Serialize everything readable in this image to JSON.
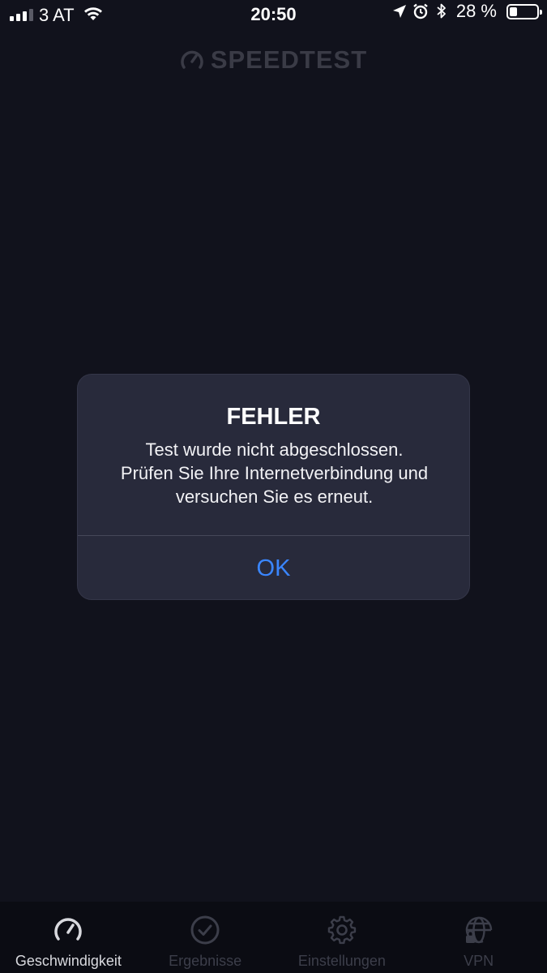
{
  "status_bar": {
    "carrier": "3 AT",
    "time": "20:50",
    "battery_percent": "28 %",
    "battery_level": 0.28,
    "icons": [
      "signal-icon",
      "wifi-icon",
      "location-arrow-icon",
      "alarm-icon",
      "bluetooth-icon",
      "battery-icon"
    ]
  },
  "header": {
    "logo_text": "SPEEDTEST"
  },
  "dialog": {
    "title": "FEHLER",
    "message_line1": "Test wurde nicht abgeschlossen.",
    "message_line2": "Prüfen Sie Ihre Internetverbindung und",
    "message_line3": "versuchen Sie es erneut.",
    "ok_label": "OK",
    "ok_color": "#3a86ff"
  },
  "tab_bar": {
    "tabs": [
      {
        "label": "Geschwindigkeit",
        "icon": "speedometer-icon",
        "active": true
      },
      {
        "label": "Ergebnisse",
        "icon": "checkmark-circle-icon",
        "active": false
      },
      {
        "label": "Einstellungen",
        "icon": "gear-icon",
        "active": false
      },
      {
        "label": "VPN",
        "icon": "globe-lock-icon",
        "active": false
      }
    ]
  }
}
